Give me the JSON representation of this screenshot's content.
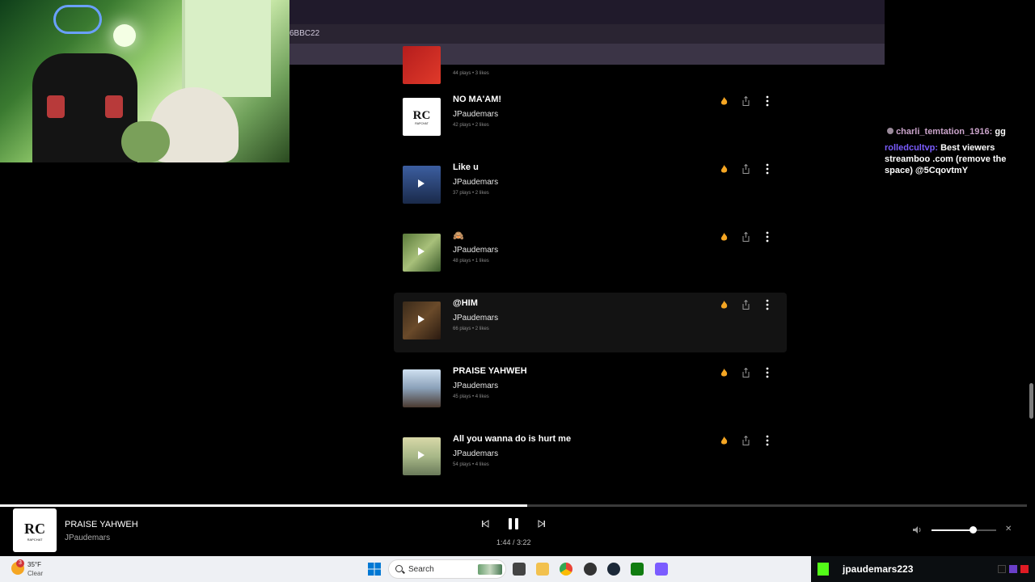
{
  "browser": {
    "url_fragment": "6BBC22"
  },
  "tracks": [
    {
      "title": "",
      "artist": "",
      "meta": "44 plays • 3 likes",
      "thumb": "red",
      "play": false
    },
    {
      "title": "NO MA'AM!",
      "artist": "JPaudemars",
      "meta": "42 plays • 2 likes",
      "thumb": "rc",
      "play": false
    },
    {
      "title": "Like u",
      "artist": "JPaudemars",
      "meta": "37 plays • 2 likes",
      "thumb": "blue",
      "play": true
    },
    {
      "title": "🙈",
      "artist": "JPaudemars",
      "meta": "48 plays • 1 likes",
      "thumb": "tree",
      "play": true
    },
    {
      "title": "@HIM",
      "artist": "JPaudemars",
      "meta": "66 plays • 2 likes",
      "thumb": "dark",
      "play": true,
      "hover": true
    },
    {
      "title": "PRAISE YAHWEH",
      "artist": "JPaudemars",
      "meta": "45 plays • 4 likes",
      "thumb": "sky",
      "play": false
    },
    {
      "title": "All you wanna do is hurt me",
      "artist": "JPaudemars",
      "meta": "54 plays • 4 likes",
      "thumb": "field",
      "play": true
    }
  ],
  "chat": {
    "line1_user": "charli_temtation_1916:",
    "line1_msg": "gg",
    "line2_user": "rolledcultvp:",
    "line2_msg": "Best viewers",
    "line3": "streamboo .com (remove the",
    "line4": "space) @5CqovtmY"
  },
  "player": {
    "title": "PRAISE YAHWEH",
    "artist": "JPaudemars",
    "time": "1:44 / 3:22",
    "progress_fraction": 0.513,
    "volume_fraction": 0.64,
    "close_label": "✕"
  },
  "taskbar": {
    "weather_temp": "35°F",
    "weather_cond": "Clear",
    "weather_badge": "3",
    "search_label": "Search",
    "kick_user": "jpaudemars223"
  },
  "colors": {
    "fire": "#f5a623",
    "kick_green": "#53fc18",
    "chat_user1": "#c9a3c9",
    "chat_user2": "#7a5cff"
  }
}
